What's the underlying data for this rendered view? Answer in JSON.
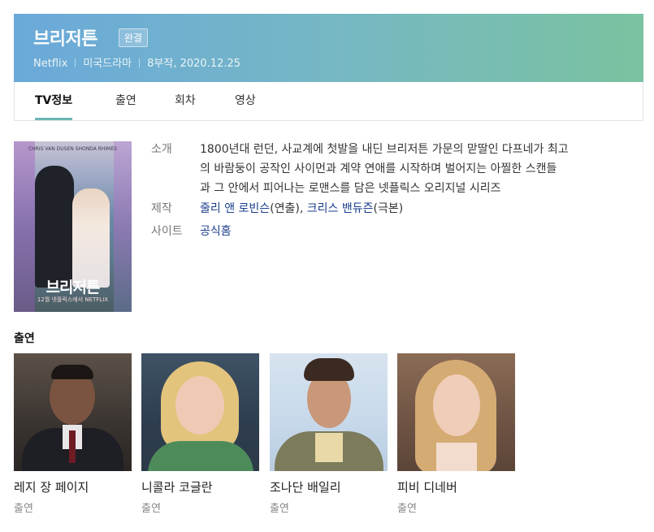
{
  "header": {
    "title": "브리저튼",
    "badge": "완결",
    "meta": [
      "Netflix",
      "미국드라마",
      "8부작, 2020.12.25"
    ],
    "gradient_start": "#6aa9da",
    "gradient_end": "#7ac2a0"
  },
  "tabs": [
    {
      "label": "TV정보",
      "active": true
    },
    {
      "label": "출연",
      "active": false
    },
    {
      "label": "회차",
      "active": false
    },
    {
      "label": "영상",
      "active": false
    }
  ],
  "poster": {
    "title": "브리저튼",
    "subtitle": "12월 넷플릭스에서 NETFLIX",
    "top_text": "CHRIS VAN DUSEN   SHONDA RHIMES"
  },
  "info": {
    "summary_label": "소개",
    "summary_lines": [
      "1800년대 런던, 사교계에 첫발을 내딘 브리저튼 가문의 맏딸인 다프네가 최고",
      "의 바람둥이 공작인 사이먼과 계약 연애를 시작하며 벌어지는 아찔한 스캔들",
      "과 그 안에서 피어나는 로맨스를 담은 넷플릭스 오리지널 시리즈"
    ],
    "production_label": "제작",
    "production_link1": "줄리 앤 로빈슨",
    "production_role1": "(연출), ",
    "production_link2": "크리스 밴듀즌",
    "production_role2": "(극본)",
    "site_label": "사이트",
    "site_link": "공식홈"
  },
  "cast_section": {
    "title": "출연",
    "members": [
      {
        "name": "레지 장 페이지",
        "role": "출연"
      },
      {
        "name": "니콜라 코글란",
        "role": "출연"
      },
      {
        "name": "조나단 배일리",
        "role": "출연"
      },
      {
        "name": "피비 디네버",
        "role": "출연"
      }
    ]
  },
  "colors": {
    "tab_active_underline": "#6db6b4",
    "link": "#1a3e8c"
  }
}
